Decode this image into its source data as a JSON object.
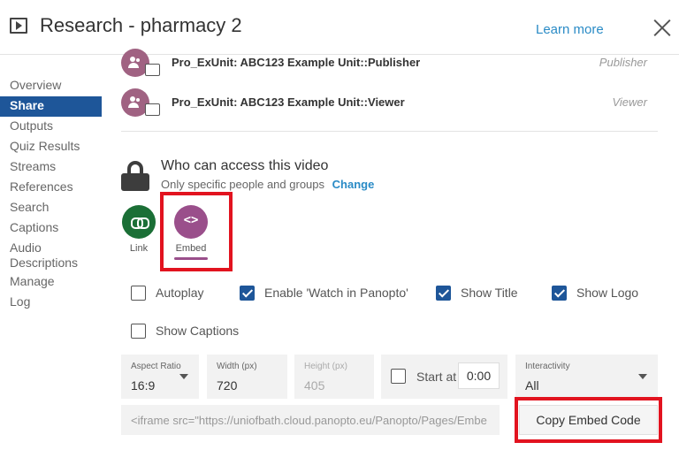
{
  "header": {
    "title": "Research - pharmacy 2",
    "learn_more": "Learn more"
  },
  "sidebar": {
    "items": [
      {
        "label": "Overview"
      },
      {
        "label": "Share",
        "active": true
      },
      {
        "label": "Outputs"
      },
      {
        "label": "Quiz Results"
      },
      {
        "label": "Streams"
      },
      {
        "label": "References"
      },
      {
        "label": "Search"
      },
      {
        "label": "Captions"
      },
      {
        "label": "Audio Descriptions"
      },
      {
        "label": "Manage"
      },
      {
        "label": "Log"
      }
    ]
  },
  "permissions": [
    {
      "name": "Pro_ExUnit: ABC123 Example Unit::Publisher",
      "role": "Publisher"
    },
    {
      "name": "Pro_ExUnit: ABC123 Example Unit::Viewer",
      "role": "Viewer"
    }
  ],
  "access": {
    "title": "Who can access this video",
    "description": "Only specific people and groups",
    "change": "Change"
  },
  "share_options": {
    "link": "Link",
    "embed": "Embed",
    "embed_glyph": "<>"
  },
  "checkboxes": {
    "autoplay": {
      "label": "Autoplay",
      "checked": false
    },
    "watch_in_panopto": {
      "label": "Enable 'Watch in Panopto'",
      "checked": true
    },
    "show_title": {
      "label": "Show Title",
      "checked": true
    },
    "show_logo": {
      "label": "Show Logo",
      "checked": true
    },
    "show_captions": {
      "label": "Show Captions",
      "checked": false
    }
  },
  "fields": {
    "aspect_ratio": {
      "label": "Aspect Ratio",
      "value": "16:9"
    },
    "width": {
      "label": "Width (px)",
      "value": "720"
    },
    "height": {
      "label": "Height (px)",
      "value": "405"
    },
    "start_at": {
      "label": "Start at",
      "value": "0:00",
      "checked": false
    },
    "interactivity": {
      "label": "Interactivity",
      "value": "All"
    }
  },
  "embed": {
    "code": "<iframe src=\"https://uniofbath.cloud.panopto.eu/Panopto/Pages/Embe",
    "copy_button": "Copy Embed Code"
  },
  "colors": {
    "accent_blue": "#1e5699",
    "link_blue": "#2a8bc6",
    "embed_purple": "#9a4f8b",
    "link_green": "#1b6f36",
    "highlight_red": "#e2131f"
  }
}
